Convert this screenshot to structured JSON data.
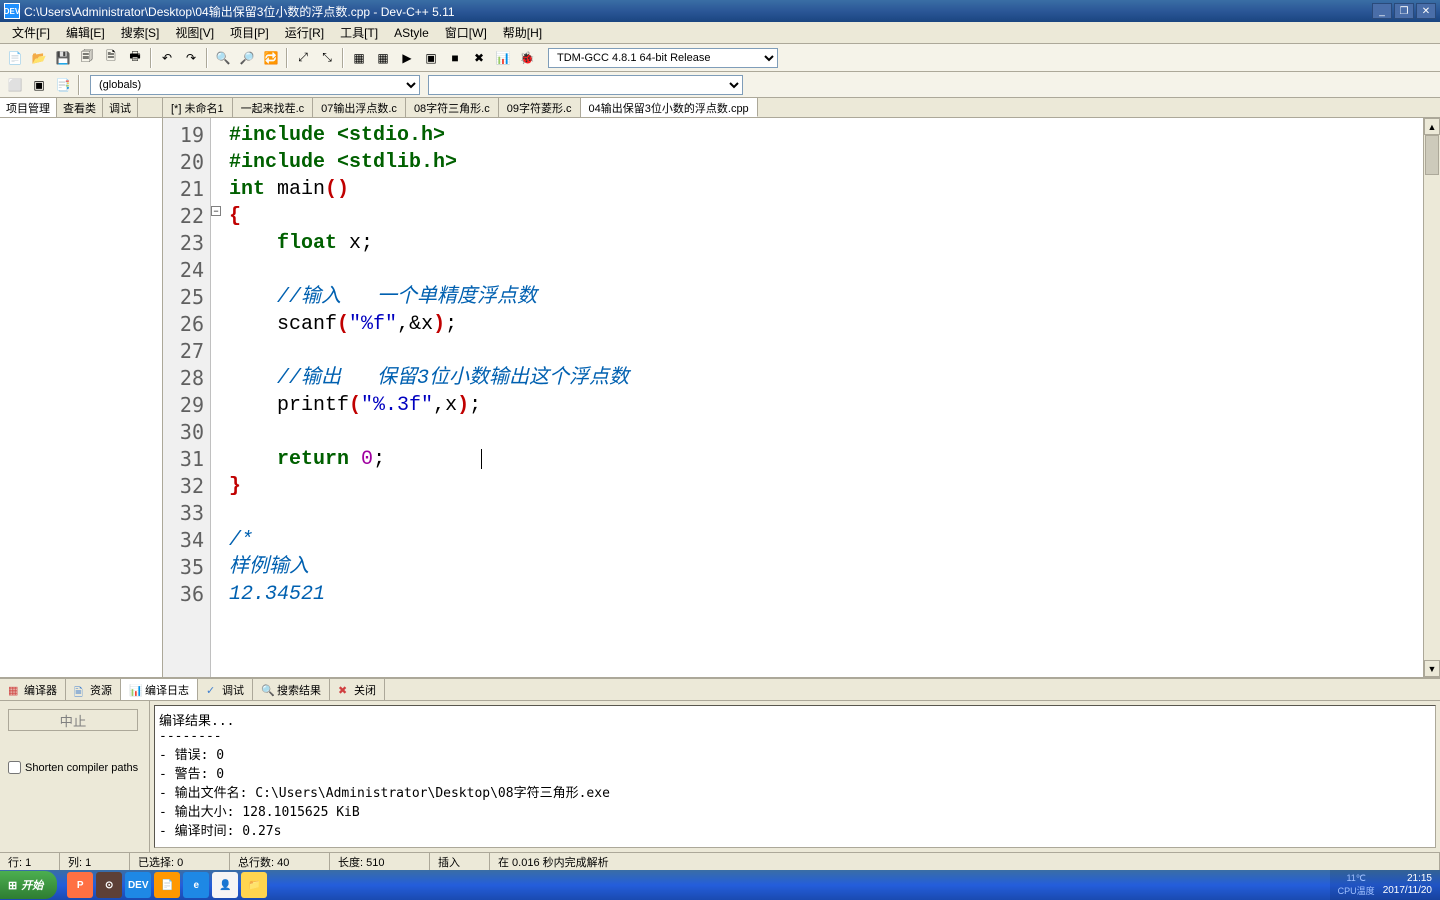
{
  "window": {
    "title": "C:\\Users\\Administrator\\Desktop\\04输出保留3位小数的浮点数.cpp - Dev-C++ 5.11",
    "icon_text": "DEV"
  },
  "menu": [
    "文件[F]",
    "编辑[E]",
    "搜索[S]",
    "视图[V]",
    "项目[P]",
    "运行[R]",
    "工具[T]",
    "AStyle",
    "窗口[W]",
    "帮助[H]"
  ],
  "toolbar_icons": [
    "📄",
    "📂",
    "💾",
    "🗐",
    "🗎",
    "🖶",
    "",
    "↶",
    "↷",
    "",
    "🔍",
    "🔎",
    "🔁",
    "",
    "⤢",
    "⤡",
    "",
    "▦",
    "▦",
    "▶",
    "▣",
    "■",
    "✖",
    "📊",
    "🐞"
  ],
  "compiler": "TDM-GCC 4.8.1 64-bit Release",
  "toolbar2_icons": [
    "⬜",
    "▣",
    "📑"
  ],
  "globals": "(globals)",
  "sidebar_tabs": [
    "项目管理",
    "查看类",
    "调试"
  ],
  "editor_tabs": [
    "[*] 未命名1",
    "一起来找茬.c",
    "07输出浮点数.c",
    "08字符三角形.c",
    "09字符菱形.c",
    "04输出保留3位小数的浮点数.cpp"
  ],
  "active_tab": 5,
  "line_start": 19,
  "code_lines": [
    {
      "t": "pre",
      "c": "#include <stdio.h>"
    },
    {
      "t": "pre",
      "c": "#include <stdlib.h>"
    },
    {
      "t": "main",
      "c": "int main()"
    },
    {
      "t": "brace",
      "c": "{"
    },
    {
      "t": "decl",
      "c": "    float x;"
    },
    {
      "t": "blank",
      "c": ""
    },
    {
      "t": "cmt",
      "c": "    //输入   一个单精度浮点数"
    },
    {
      "t": "scanf",
      "c": "    scanf(\"%f\",&x);"
    },
    {
      "t": "blank",
      "c": ""
    },
    {
      "t": "cmt",
      "c": "    //输出   保留3位小数输出这个浮点数"
    },
    {
      "t": "printf",
      "c": "    printf(\"%.3f\",x);"
    },
    {
      "t": "blank",
      "c": ""
    },
    {
      "t": "return",
      "c": "    return 0;"
    },
    {
      "t": "brace",
      "c": "}"
    },
    {
      "t": "blank",
      "c": ""
    },
    {
      "t": "cmt2",
      "c": "/*"
    },
    {
      "t": "cmt2",
      "c": "样例输入"
    },
    {
      "t": "cmt2",
      "c": "12.34521"
    }
  ],
  "bottom_tabs": [
    {
      "icon": "▦",
      "label": "编译器",
      "color": "#d04040"
    },
    {
      "icon": "🗎",
      "label": "资源",
      "color": "#4080d0"
    },
    {
      "icon": "📊",
      "label": "编译日志",
      "color": "#6040a0"
    },
    {
      "icon": "✓",
      "label": "调试",
      "color": "#4080d0"
    },
    {
      "icon": "🔍",
      "label": "搜索结果",
      "color": "#4080d0"
    },
    {
      "icon": "✖",
      "label": "关闭",
      "color": "#d04040"
    }
  ],
  "active_bottom_tab": 2,
  "stop_btn": "中止",
  "shorten_label": "Shorten compiler paths",
  "compile_output": "编译结果...\n--------\n- 错误: 0\n- 警告: 0\n- 输出文件名: C:\\Users\\Administrator\\Desktop\\08字符三角形.exe\n- 输出大小: 128.1015625 KiB\n- 编译时间: 0.27s",
  "status": {
    "line": "行:  1",
    "col": "列:  1",
    "sel": "已选择:  0",
    "total": "总行数:  40",
    "len": "长度:  510",
    "mode": "插入",
    "parse": "在 0.016 秒内完成解析"
  },
  "taskbar": {
    "start": "开始",
    "temp": "11℃\nCPU温度",
    "time": "21:15",
    "date": "2017/11/20"
  },
  "task_icons": [
    {
      "bg": "#ff7043",
      "t": "P"
    },
    {
      "bg": "#5d4037",
      "t": "⊙"
    },
    {
      "bg": "#1e88e5",
      "t": "DEV"
    },
    {
      "bg": "#ff9800",
      "t": "📄"
    },
    {
      "bg": "#1e88e5",
      "t": "e"
    },
    {
      "bg": "#f5f5f5",
      "t": "👤"
    },
    {
      "bg": "#ffd54f",
      "t": "📁"
    }
  ]
}
